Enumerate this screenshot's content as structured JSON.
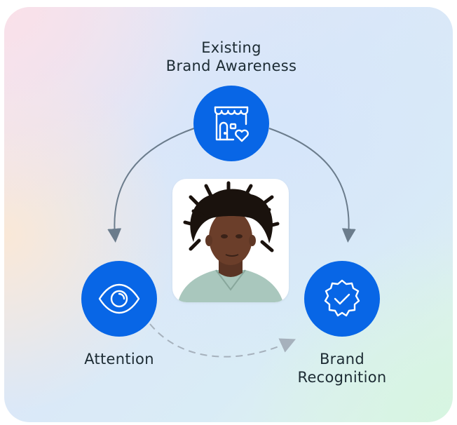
{
  "diagram": {
    "top_node": {
      "label": "Existing\nBrand Awareness",
      "icon": "storefront-heart-icon"
    },
    "left_node": {
      "label": "Attention",
      "icon": "eye-icon"
    },
    "right_node": {
      "label": "Brand\nRecognition",
      "icon": "verified-badge-icon"
    },
    "center_image": {
      "subject": "portrait-photo"
    },
    "colors": {
      "node_fill": "#0866E6",
      "icon_stroke": "#FFFFFF",
      "arrow_solid": "#6B7C8C",
      "arrow_dashed": "#A6B1BC",
      "text": "#1C2B33"
    }
  }
}
